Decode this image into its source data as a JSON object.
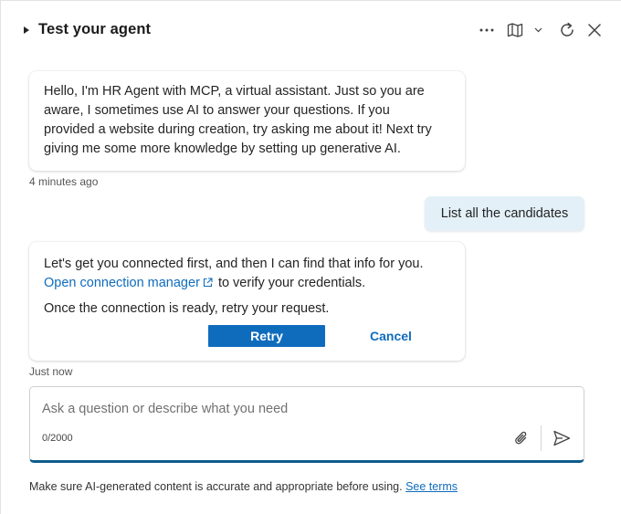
{
  "header": {
    "title": "Test your agent"
  },
  "icons": {
    "collapse": "caret-right-icon",
    "more": "more-horizontal-icon",
    "map": "map-icon",
    "dropdown": "chevron-down-icon",
    "refresh": "refresh-icon",
    "close": "close-icon",
    "external_link": "external-link-icon",
    "attach": "paperclip-icon",
    "send": "send-icon"
  },
  "messages": {
    "bot_greeting": {
      "lines": [
        "Hello, I'm HR Agent with MCP, a virtual assistant. Just so you are",
        "aware, I sometimes use AI to answer your questions. If you",
        "provided a website during creation, try asking me about it! Next try",
        "giving me some more knowledge by setting up generative AI."
      ],
      "timestamp": "4 minutes ago"
    },
    "user_message": {
      "text": "List all the candidates"
    },
    "bot_connection": {
      "line1": "Let's get you connected first, and then I can find that info for you.",
      "link_text": "Open connection manager",
      "line2_suffix": "to verify your credentials.",
      "line3": "Once the connection is ready, retry your request.",
      "retry_label": "Retry",
      "cancel_label": "Cancel",
      "timestamp": "Just now"
    }
  },
  "composer": {
    "placeholder": "Ask a question or describe what you need",
    "value": "",
    "char_count": "0/2000"
  },
  "footer": {
    "disclaimer": "Make sure AI-generated content is accurate and appropriate before using.",
    "link_text": "See terms"
  },
  "colors": {
    "accent": "#0f6cbd",
    "user_bubble": "#e3f0f7",
    "input_underline": "#0f5c8c"
  }
}
